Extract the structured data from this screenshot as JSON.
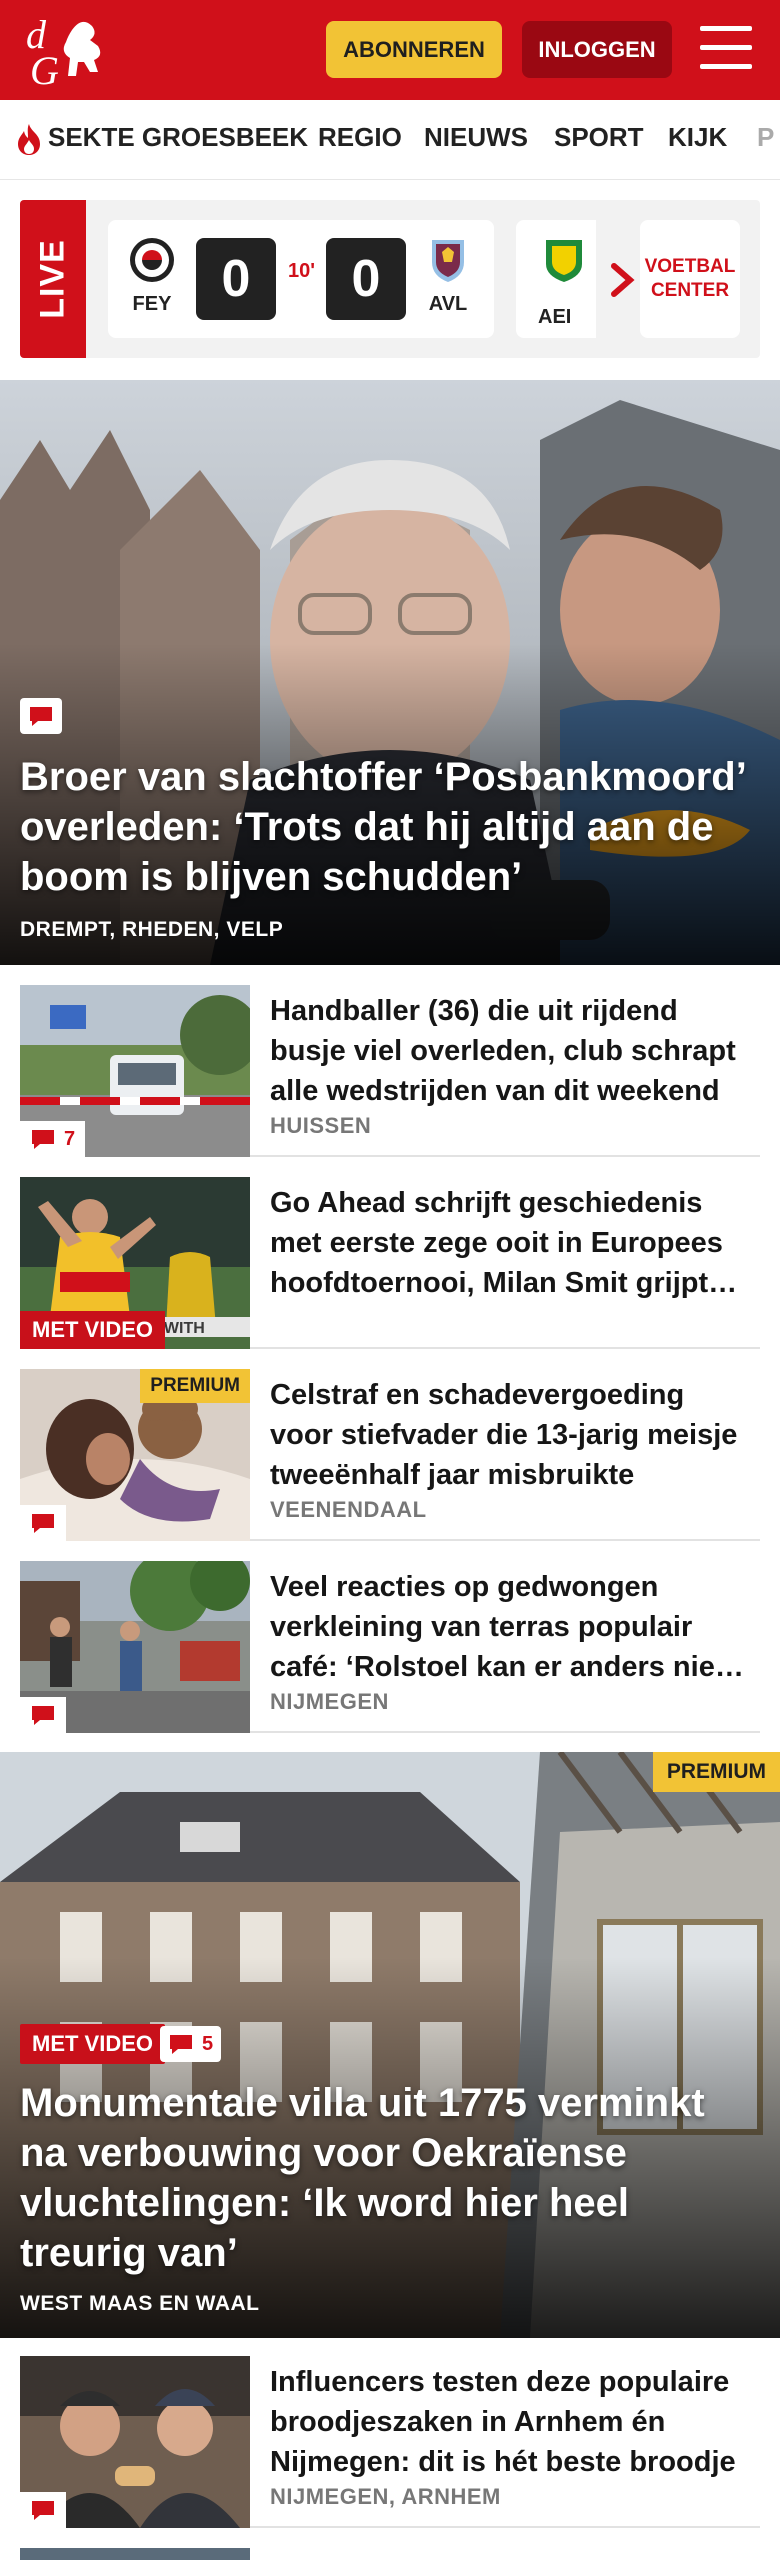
{
  "header": {
    "logo_text": "dG",
    "subscribe_label": "ABONNEREN",
    "login_label": "INLOGGEN",
    "brand_color": "#d0101a"
  },
  "nav": {
    "items": [
      "SEKTE GROESBEEK",
      "REGIO",
      "NIEUWS",
      "SPORT",
      "KIJK",
      "P"
    ]
  },
  "live": {
    "tag": "LIVE",
    "match": {
      "home_abbr": "FEY",
      "home_score": "0",
      "minute": "10'",
      "away_score": "0",
      "away_abbr": "AVL"
    },
    "next_match_abbr": "AEI",
    "voetbal_center_label": "VOETBAL CENTER"
  },
  "hero": {
    "title": "Broer van slachtoffer ‘Posbankmoord’ overleden: ‘Trots dat hij altijd aan de boom is blijven schudden’",
    "location": "DREMPT, RHEDEN, VELP"
  },
  "articles": [
    {
      "title": "Handballer (36) die uit rijdend busje viel overleden, club schrapt alle wedstrijden van dit weekend",
      "location": "HUISSEN",
      "comments": "7"
    },
    {
      "title": "Go Ahead schrijft geschiedenis met eerste zege ooit in Europees hoofdtoernooi, Milan Smit grijpt hoofdrol",
      "location": "",
      "badge": "MET VIDEO"
    },
    {
      "title": "Celstraf en schadevergoeding voor stiefvader die 13-jarig meisje tweeënhalf jaar misbruikte",
      "location": "VEENENDAAL",
      "badge": "PREMIUM"
    },
    {
      "title": "Veel reacties op gedwongen verkleining van terras populair café: ‘Rolstoel kan er anders niet langs’",
      "location": "NIJMEGEN"
    }
  ],
  "feature": {
    "premium": "PREMIUM",
    "video_badge": "MET VIDEO",
    "comments": "5",
    "title": "Monumentale villa uit 1775 verminkt na verbouwing voor Oekraïense vluchtelingen: ‘Ik word hier heel treurig van’",
    "location": "WEST MAAS EN WAAL"
  },
  "article_bottom": {
    "title": "Influencers testen deze populaire broodjeszaken in Arnhem én Nijmegen: dit is hét beste broodje",
    "location": "NIJMEGEN, ARNHEM"
  }
}
